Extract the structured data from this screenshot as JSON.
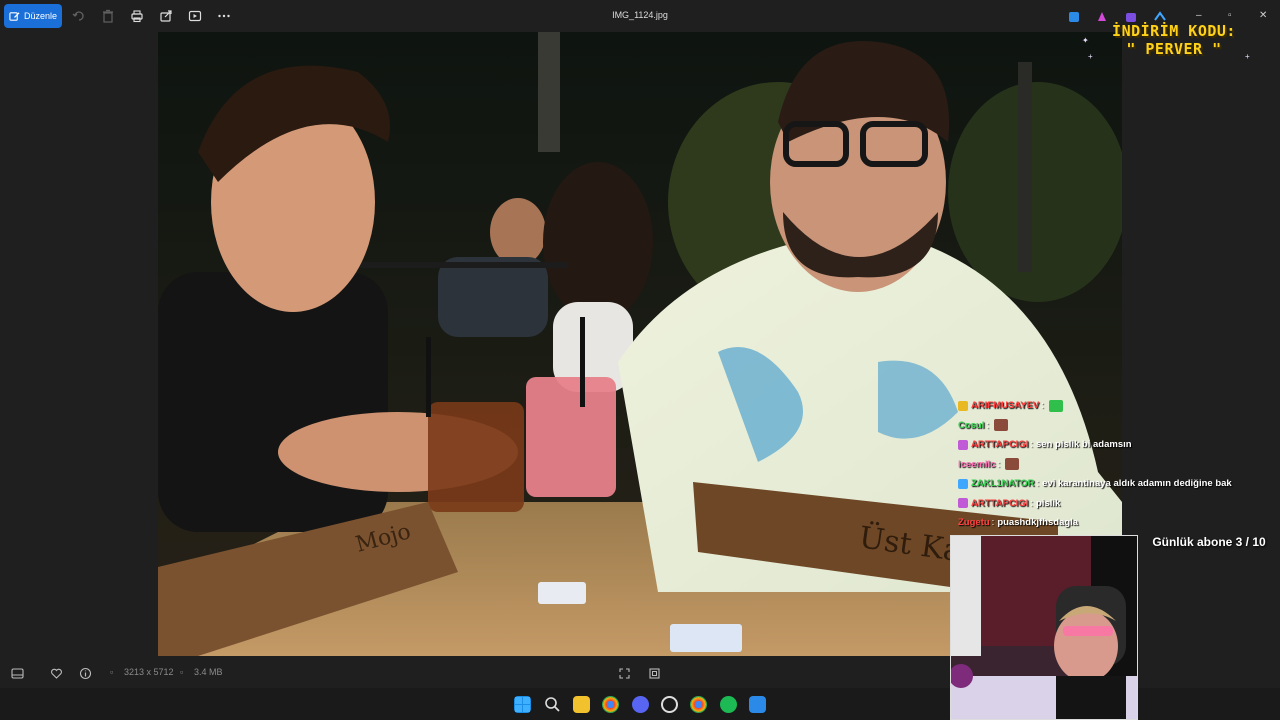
{
  "toolbar": {
    "edit_label": "Düzenle",
    "file_name": "IMG_1124.jpg"
  },
  "infobar": {
    "dimensions": "3213 x 5712",
    "file_size": "3.4 MB"
  },
  "overlay": {
    "promo_line1": "İNDİRİM KODU:",
    "promo_line2": "\" PERVER \"",
    "sub_goal": "Günlük abone 3 / 10",
    "chat": [
      {
        "user": "ARIFMUSAYEV",
        "sep": ":",
        "message": "",
        "color": "#ff3d3d",
        "badge": "#e8b923",
        "emote": "#2fbf4a"
      },
      {
        "user": "Cosul",
        "sep": ":",
        "message": "",
        "color": "#39d353",
        "badge": "",
        "emote": "#8a4b3a"
      },
      {
        "user": "ARTTAPCIGI",
        "sep": ":",
        "message": "sen pislik bi adamsın",
        "color": "#ff3d3d",
        "badge": "#c05ad6",
        "emote": ""
      },
      {
        "user": "iceemilc",
        "sep": ":",
        "message": "",
        "color": "#ff6bb5",
        "badge": "",
        "emote": "#8a4b3a"
      },
      {
        "user": "ZAKL1NATOR",
        "sep": ":",
        "message": "evi karantinaya aldık adamın dediğine bak",
        "color": "#39d353",
        "badge": "#3fa7ff",
        "emote": ""
      },
      {
        "user": "ARTTAPCIGI",
        "sep": ":",
        "message": "pislik",
        "color": "#ff3d3d",
        "badge": "#c05ad6",
        "emote": ""
      },
      {
        "user": "Zugetu",
        "sep": ":",
        "message": "puashdkjfhsdagla",
        "color": "#ff4040",
        "badge": "",
        "emote": ""
      }
    ]
  },
  "colors": {
    "accent": "#1a6fd9",
    "promo": "#ffd21a"
  },
  "icons": [
    "edit-icon",
    "rotate-icon",
    "delete-icon",
    "print-icon",
    "share-icon",
    "slideshow-icon",
    "more-icon",
    "filmstrip-icon",
    "favorite-icon",
    "info-icon",
    "fit-icon",
    "zoom-icon"
  ]
}
